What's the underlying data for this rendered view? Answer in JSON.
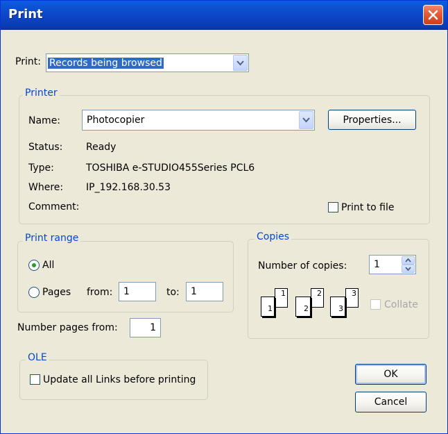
{
  "window": {
    "title": "Print"
  },
  "print_what": {
    "label": "Print:",
    "value": "Records being browsed"
  },
  "printer": {
    "group_title": "Printer",
    "name_label": "Name:",
    "name_value": "Photocopier",
    "properties_label": "Properties...",
    "status_label": "Status:",
    "status_value": "Ready",
    "type_label": "Type:",
    "type_value": "TOSHIBA e-STUDIO455Series PCL6",
    "where_label": "Where:",
    "where_value": "IP_192.168.30.53",
    "comment_label": "Comment:",
    "print_to_file_label": "Print to file"
  },
  "print_range": {
    "group_title": "Print range",
    "all_label": "All",
    "pages_label": "Pages",
    "from_label": "from:",
    "from_value": "1",
    "to_label": "to:",
    "to_value": "1",
    "selected": "All"
  },
  "copies": {
    "group_title": "Copies",
    "number_label": "Number of copies:",
    "number_value": "1",
    "collate_label": "Collate",
    "collate_icons": [
      {
        "back": "1",
        "front": "1"
      },
      {
        "back": "2",
        "front": "2"
      },
      {
        "back": "3",
        "front": "3"
      }
    ]
  },
  "number_pages_from": {
    "label": "Number pages from:",
    "value": "1"
  },
  "ole": {
    "group_title": "OLE",
    "update_links_label": "Update all Links before printing"
  },
  "buttons": {
    "ok": "OK",
    "cancel": "Cancel"
  },
  "colors": {
    "titlebar": "#0b58d8",
    "dialog_bg": "#ece9d8",
    "group_title": "#0046d5",
    "selection": "#316ac5"
  }
}
